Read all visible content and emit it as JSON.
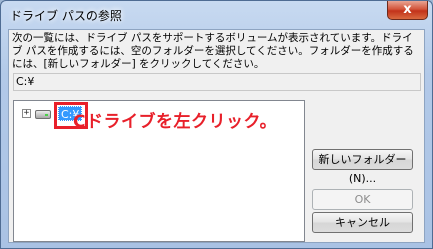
{
  "window": {
    "title": "ドライブ パスの参照",
    "close_label": "x"
  },
  "dialog": {
    "description": "次の一覧には、ドライブ パスをサポートするボリュームが表示されています。ドライブ パスを作成するには、空のフォルダーを選択してください。フォルダーを作成するには、[新しいフォルダー] をクリックしてください。",
    "path_value": "C:¥",
    "tree": {
      "expander": "+",
      "drive_label": "C:¥"
    },
    "annotation": "Cドライブを左クリック。",
    "buttons": {
      "new_folder": "新しいフォルダー(N)...",
      "ok": "OK",
      "cancel": "キャンセル"
    }
  },
  "colors": {
    "annotation": "#e8202a",
    "selection": "#3399ff"
  }
}
